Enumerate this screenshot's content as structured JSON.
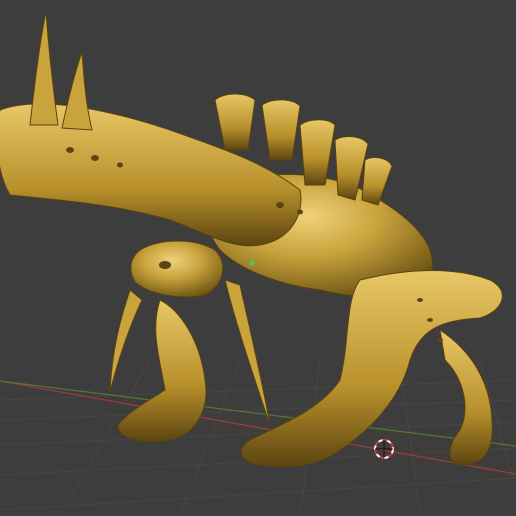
{
  "viewport": {
    "background": "#3d3d3d",
    "grid_color": "#464646",
    "x_axis_color": "#a23b3b",
    "y_axis_color": "#4f7a33",
    "model_color": "#c9a33c",
    "model_shadow": "#6b5212",
    "model_highlight": "#f0d27a"
  },
  "model": {
    "description_icon": "sculpted-creature-model"
  },
  "cursor": {
    "icon": "3d-cursor-icon"
  }
}
